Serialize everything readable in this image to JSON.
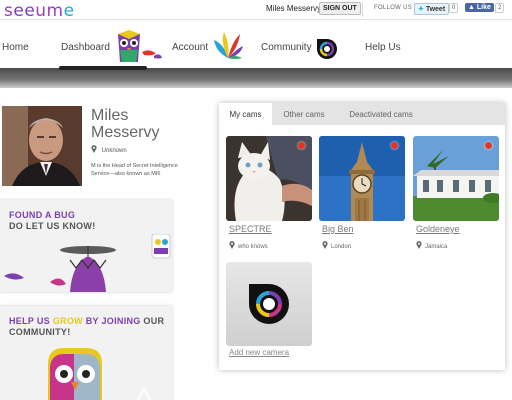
{
  "header": {
    "logo": "seeume",
    "username": "Miles Messervy",
    "signout_label": "SIGN OUT",
    "follow_label": "FOLLOW US",
    "tweet_label": "Tweet",
    "tweet_count": "0",
    "like_label": "Like",
    "like_count": "2"
  },
  "nav": {
    "items": [
      "Home",
      "Dashboard",
      "Account",
      "Community",
      "Help Us"
    ]
  },
  "profile": {
    "name_line1": "Miles",
    "name_line2": "Messervy",
    "location": "Unknown",
    "description": "M is the Head of Secret Intelligence Service—also known as MI6"
  },
  "bug_card": {
    "line1_a": "FOUND A ",
    "line1_b": "BUG",
    "line2": "DO LET US KNOW!"
  },
  "help_card": {
    "a": "HELP US ",
    "b": "GROW",
    "c": " BY ",
    "d": "JOINING",
    "e": " OUR",
    "f": "COMMUNITY!"
  },
  "cams": {
    "tabs": [
      "My cams",
      "Other cams",
      "Deactivated cams"
    ],
    "list": [
      {
        "name": "SPECTRE",
        "location": "who knows"
      },
      {
        "name": "Big Ben",
        "location": "London"
      },
      {
        "name": "Goldeneye",
        "location": "Jamaica"
      }
    ],
    "add_label": "Add new camera"
  },
  "colors": {
    "brand_purple": "#7a3fb8",
    "brand_blue": "#2aa3d8",
    "live_red": "#e83322",
    "yellow_accent": "#e8c81a"
  }
}
